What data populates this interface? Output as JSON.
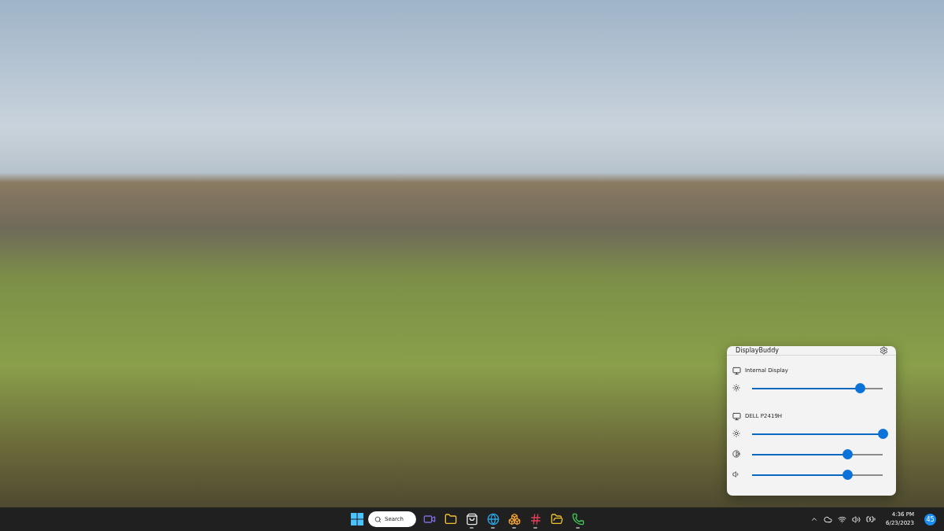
{
  "flyout": {
    "title": "DisplayBuddy",
    "displays": [
      {
        "name": "Internal Display",
        "controls": [
          {
            "kind": "brightness",
            "level": 0.83
          }
        ]
      },
      {
        "name": "DELL P2419H",
        "controls": [
          {
            "kind": "brightness",
            "level": 1.0
          },
          {
            "kind": "contrast",
            "level": 0.73
          },
          {
            "kind": "volume",
            "level": 0.73
          }
        ]
      }
    ]
  },
  "taskbar": {
    "search": "Search",
    "apps": [
      {
        "kind": "chat",
        "running": false
      },
      {
        "kind": "folder",
        "running": false
      },
      {
        "kind": "store",
        "running": true
      },
      {
        "kind": "browser",
        "running": true
      },
      {
        "kind": "boxes",
        "running": true
      },
      {
        "kind": "hash",
        "running": true
      },
      {
        "kind": "files",
        "running": false
      },
      {
        "kind": "phone",
        "running": true
      }
    ],
    "time": "4:36 PM",
    "date": "6/23/2023",
    "badge": "45"
  }
}
